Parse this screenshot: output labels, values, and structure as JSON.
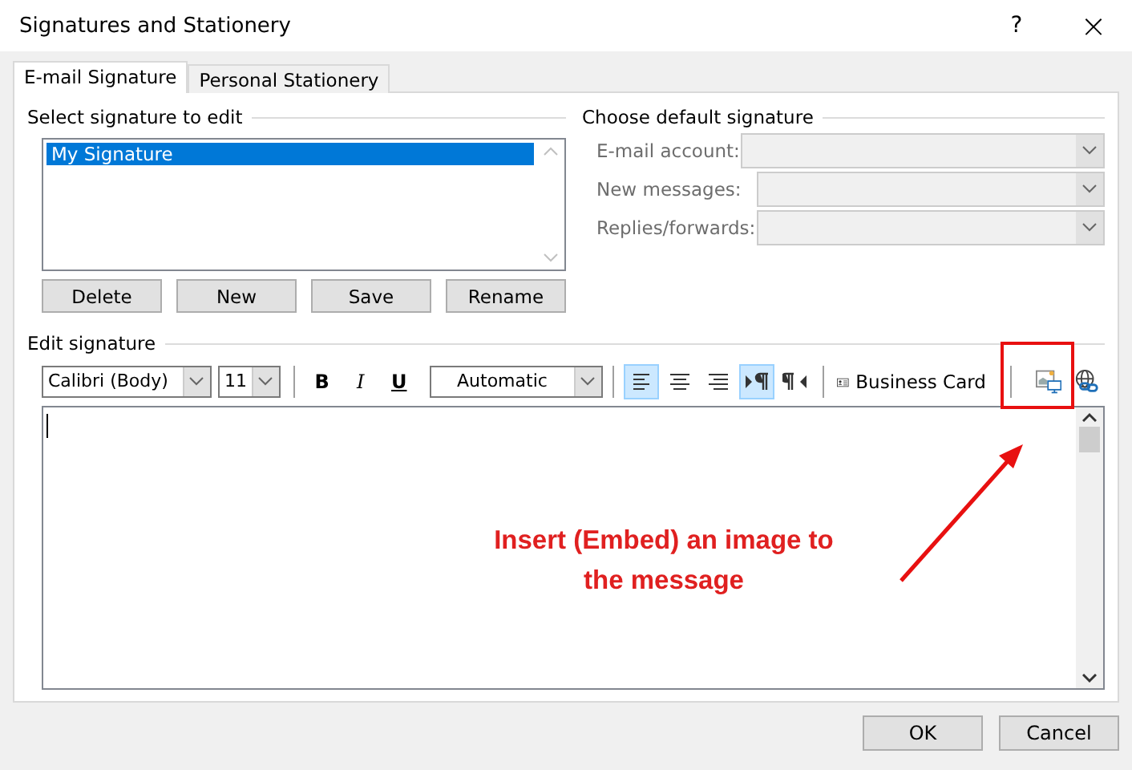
{
  "window": {
    "title": "Signatures and Stationery",
    "help": "?",
    "close": "×"
  },
  "tabs": [
    {
      "label": "E-mail Signature",
      "selected": true
    },
    {
      "label": "Personal Stationery",
      "selected": false
    }
  ],
  "select_signature": {
    "label": "Select signature to edit",
    "items": [
      {
        "label": "My Signature",
        "selected": true
      }
    ],
    "buttons": [
      "Delete",
      "New",
      "Save",
      "Rename"
    ]
  },
  "default_signature": {
    "label": "Choose default signature",
    "fields": [
      {
        "label": "E-mail account:",
        "disabled": true
      },
      {
        "label": "New messages:",
        "disabled": true
      },
      {
        "label": "Replies/forwards:",
        "disabled": true
      }
    ]
  },
  "edit_signature": {
    "label": "Edit signature",
    "font": "Calibri (Body)",
    "size": "11",
    "font_color": "Automatic",
    "tools": [
      {
        "kind": "bold",
        "label": "B",
        "selected": false
      },
      {
        "kind": "italic",
        "label": "I",
        "selected": false
      },
      {
        "kind": "underline",
        "label": "U",
        "selected": false
      },
      {
        "kind": "color"
      },
      {
        "kind": "align-left",
        "selected": true
      },
      {
        "kind": "align-center",
        "selected": false
      },
      {
        "kind": "align-right",
        "selected": false
      },
      {
        "kind": "ltr",
        "selected": true
      },
      {
        "kind": "rtl",
        "selected": false
      },
      {
        "kind": "business-card",
        "label": "Business Card"
      },
      {
        "kind": "picture"
      },
      {
        "kind": "hyperlink"
      }
    ]
  },
  "annotation": {
    "text": "Insert (Embed) an image to the message"
  },
  "buttons": [
    "OK",
    "Cancel"
  ]
}
